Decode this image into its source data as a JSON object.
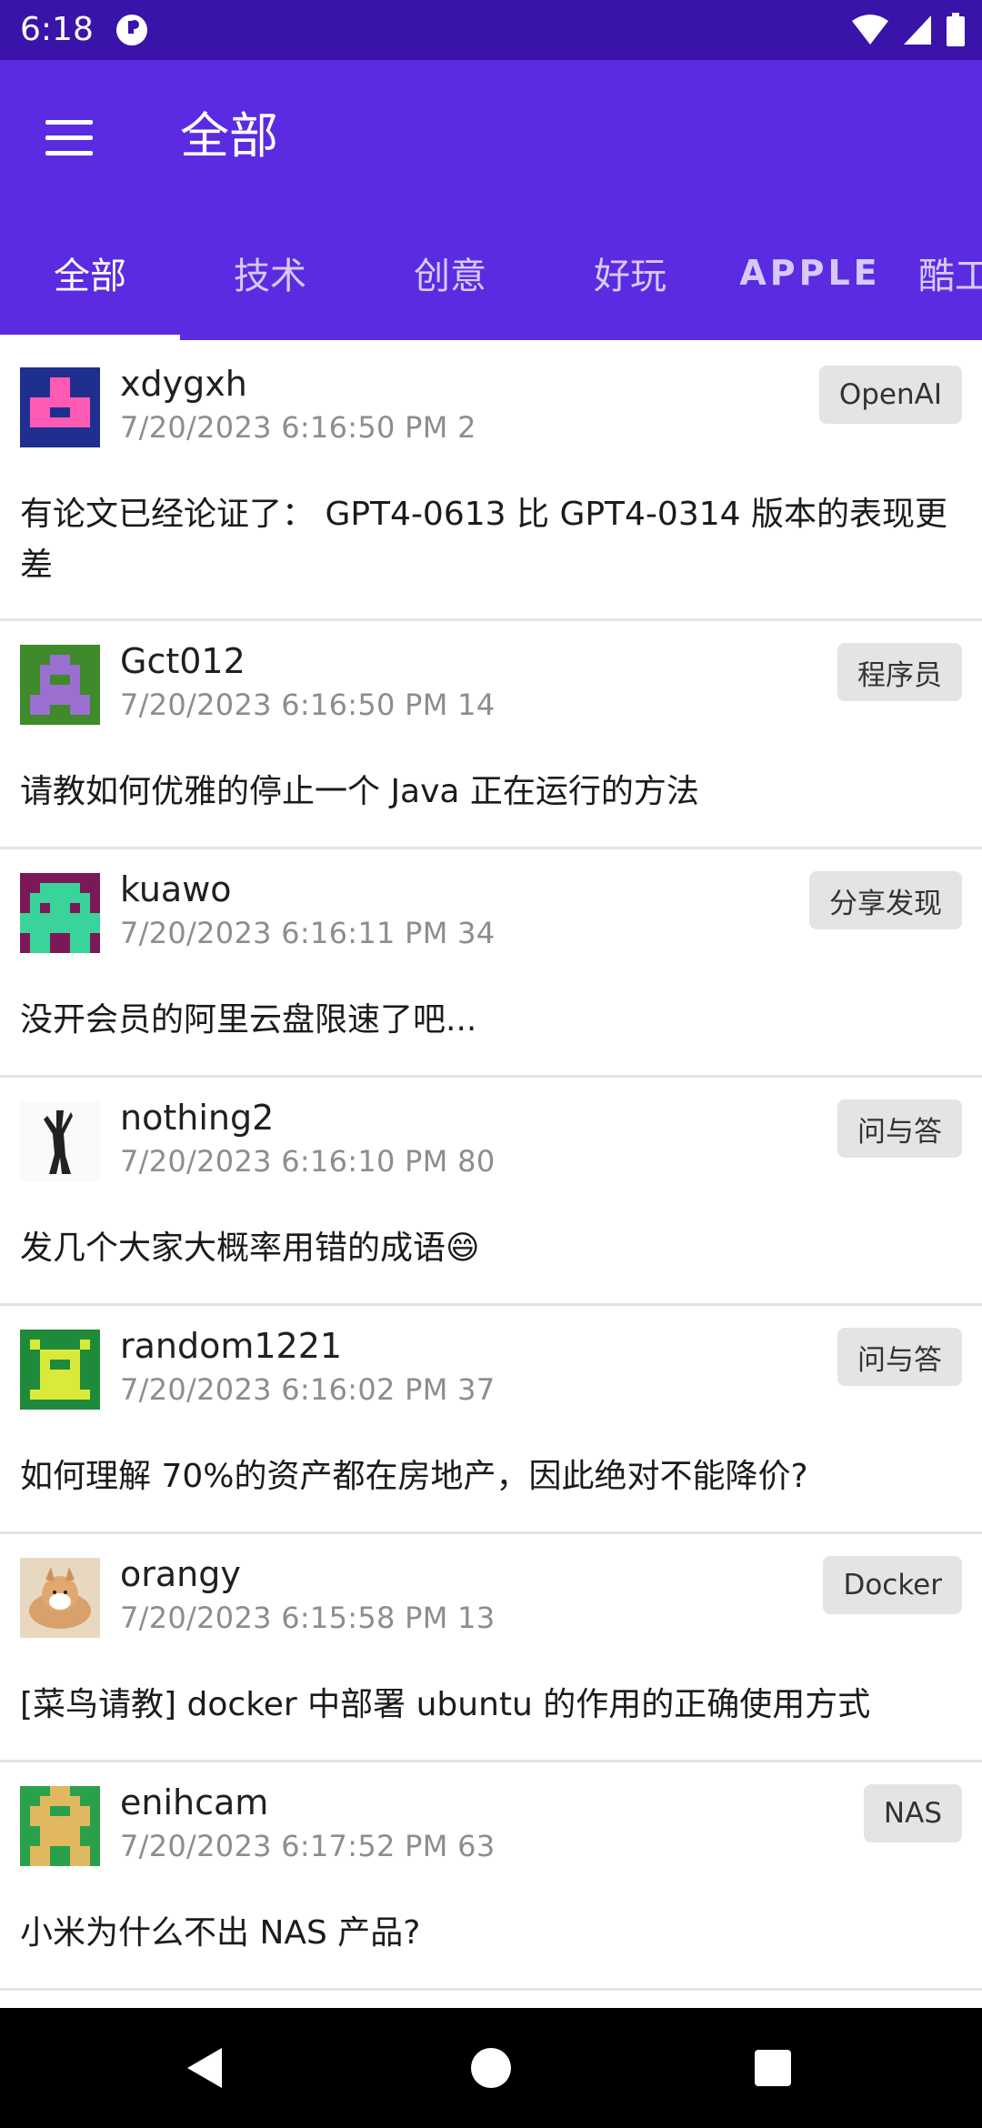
{
  "status": {
    "time": "6:18"
  },
  "appbar": {
    "title": "全部",
    "menu_icon": "hamburger-menu-icon"
  },
  "tabs": [
    {
      "label": "全部",
      "active": true
    },
    {
      "label": "技术"
    },
    {
      "label": "创意"
    },
    {
      "label": "好玩"
    },
    {
      "label": "APPLE"
    },
    {
      "label": "酷工作"
    }
  ],
  "posts": [
    {
      "username": "xdygxh",
      "meta": "7/20/2023 6:16:50 PM 2",
      "tag": "OpenAI",
      "title": "有论文已经论证了： GPT4-0613 比 GPT4-0314 版本的表现更差"
    },
    {
      "username": "Gct012",
      "meta": "7/20/2023 6:16:50 PM 14",
      "tag": "程序员",
      "title": "请教如何优雅的停止一个 Java 正在运行的方法"
    },
    {
      "username": "kuawo",
      "meta": "7/20/2023 6:16:11 PM 34",
      "tag": "分享发现",
      "title": "没开会员的阿里云盘限速了吧..."
    },
    {
      "username": "nothing2",
      "meta": "7/20/2023 6:16:10 PM 80",
      "tag": "问与答",
      "title": "发几个大家大概率用错的成语😄"
    },
    {
      "username": "random1221",
      "meta": "7/20/2023 6:16:02 PM 37",
      "tag": "问与答",
      "title": "如何理解 70%的资产都在房地产，因此绝对不能降价?"
    },
    {
      "username": "orangy",
      "meta": "7/20/2023 6:15:58 PM 13",
      "tag": "Docker",
      "title": "[菜鸟请教] docker 中部署 ubuntu 的作用的正确使用方式"
    },
    {
      "username": "enihcam",
      "meta": "7/20/2023 6:17:52 PM 63",
      "tag": "NAS",
      "title": "小米为什么不出 NAS 产品?"
    }
  ],
  "colors": {
    "status_bar": "#3a14a8",
    "app_bar": "#5b2be1",
    "tag_bg": "#e4e4e4"
  }
}
